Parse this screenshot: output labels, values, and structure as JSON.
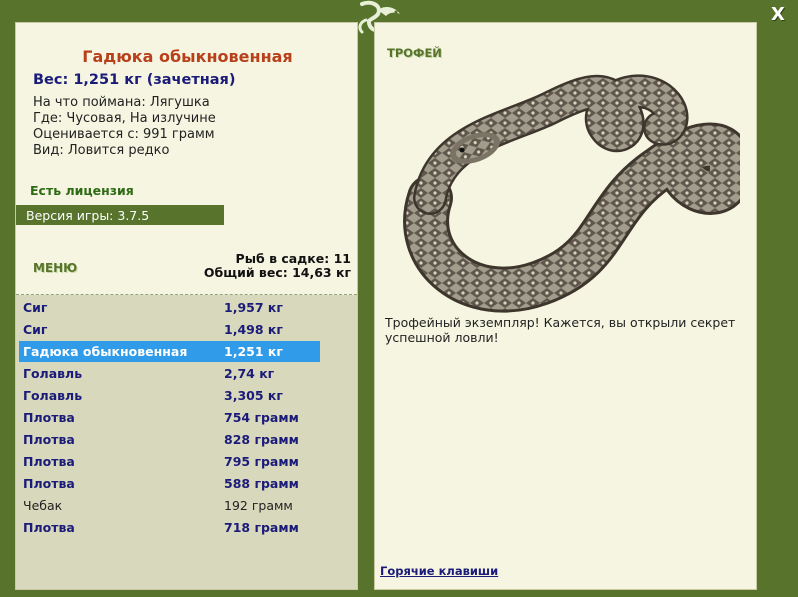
{
  "fish": {
    "title": "Гадюка обыкновенная",
    "weight_line": "Вес: 1,251 кг (зачетная)",
    "caught_on": "На что поймана: Лягушка",
    "location": "Где: Чусовая, На излучине",
    "valued_from": "Оценивается с: 991 грамм",
    "kind": "Вид: Ловится редко"
  },
  "license": "Есть лицензия",
  "version": "Версия игры: 3.7.5",
  "menu": {
    "label": "МЕНЮ"
  },
  "keepnet": {
    "count": "Рыб в садке: 11",
    "total": "Общий вес: 14,63 кг"
  },
  "catch_list": [
    {
      "name": "Сиг",
      "weight": "1,957 кг",
      "style": "bold"
    },
    {
      "name": "Сиг",
      "weight": "1,498 кг",
      "style": "bold"
    },
    {
      "name": "Гадюка обыкновенная",
      "weight": "1,251 кг",
      "style": "selected"
    },
    {
      "name": "Голавль",
      "weight": "2,74 кг",
      "style": "bold"
    },
    {
      "name": "Голавль",
      "weight": "3,305 кг",
      "style": "bold"
    },
    {
      "name": "Плотва",
      "weight": "754 грамм",
      "style": "bold"
    },
    {
      "name": "Плотва",
      "weight": "828 грамм",
      "style": "bold"
    },
    {
      "name": "Плотва",
      "weight": "795 грамм",
      "style": "bold"
    },
    {
      "name": "Плотва",
      "weight": "588 грамм",
      "style": "bold"
    },
    {
      "name": "Чебак",
      "weight": "192 грамм",
      "style": "normal"
    },
    {
      "name": "Плотва",
      "weight": "718 грамм",
      "style": "bold"
    }
  ],
  "trophy": {
    "label": "ТРОФЕЙ",
    "image": "viper-trophy-image",
    "text": "Трофейный экземпляр! Кажется, вы открыли секрет успешной ловли!"
  },
  "hotkeys": "Горячие клавиши",
  "close": "X",
  "colors": {
    "frame": "#58742c",
    "panel": "#f5f5e1",
    "list_bg": "#d8d8bc",
    "title": "#b8401b",
    "accent_blue": "#1b1b7a",
    "selection": "#2f9be9",
    "license": "#2f6a14"
  }
}
